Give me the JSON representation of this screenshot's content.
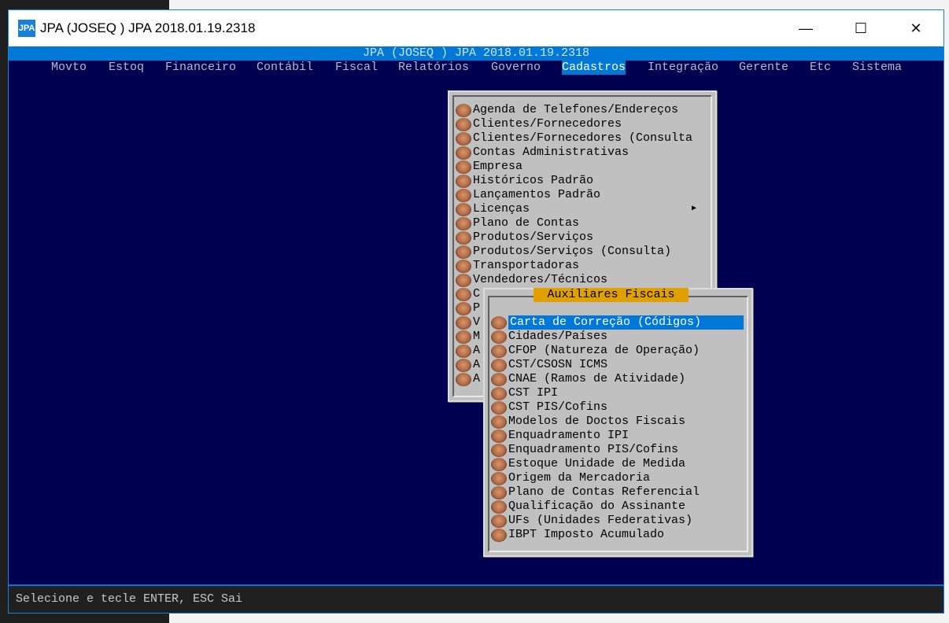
{
  "window": {
    "title": "JPA (JOSEQ ) JPA 2018.01.19.2318",
    "icon_text": "JPA",
    "header_band": "JPA (JOSEQ ) JPA 2018.01.19.2318",
    "minimize": "—",
    "maximize": "☐",
    "close": "✕"
  },
  "menubar": [
    {
      "label": "Movto"
    },
    {
      "label": "Estoq"
    },
    {
      "label": "Financeiro"
    },
    {
      "label": "Contábil"
    },
    {
      "label": "Fiscal"
    },
    {
      "label": "Relatórios"
    },
    {
      "label": "Governo"
    },
    {
      "label": "Cadastros",
      "active": true
    },
    {
      "label": "Integração"
    },
    {
      "label": "Gerente"
    },
    {
      "label": "Etc"
    },
    {
      "label": "Sistema"
    }
  ],
  "cadastros_menu": [
    "Agenda de Telefones/Endereços",
    "Clientes/Fornecedores",
    "Clientes/Fornecedores (Consulta",
    "Contas Administrativas",
    "Empresa",
    "Históricos Padrão",
    "Lançamentos Padrão",
    "Licenças",
    "Plano de Contas",
    "Produtos/Serviços",
    "Produtos/Serviços (Consulta)",
    "Transportadoras",
    "Vendedores/Técnicos",
    "C",
    "P",
    "V",
    "M",
    "A",
    "A",
    "A"
  ],
  "submenu_arrow": "▶",
  "auxiliares_menu": {
    "title": "Auxiliares Fiscais",
    "selected_index": 0,
    "items": [
      "Carta de Correção (Códigos)",
      "Cidades/Países",
      "CFOP (Natureza de Operação)",
      "CST/CSOSN ICMS",
      "CNAE (Ramos de Atividade)",
      "CST IPI",
      "CST PIS/Cofins",
      "Modelos de Doctos Fiscais",
      "Enquadramento IPI",
      "Enquadramento PIS/Cofins",
      "Estoque Unidade de Medida",
      "Origem da Mercadoria",
      "Plano de Contas Referencial",
      "Qualificação do Assinante",
      "UFs (Unidades Federativas)",
      "IBPT Imposto Acumulado"
    ]
  },
  "status": "Selecione e tecle ENTER, ESC Sai"
}
